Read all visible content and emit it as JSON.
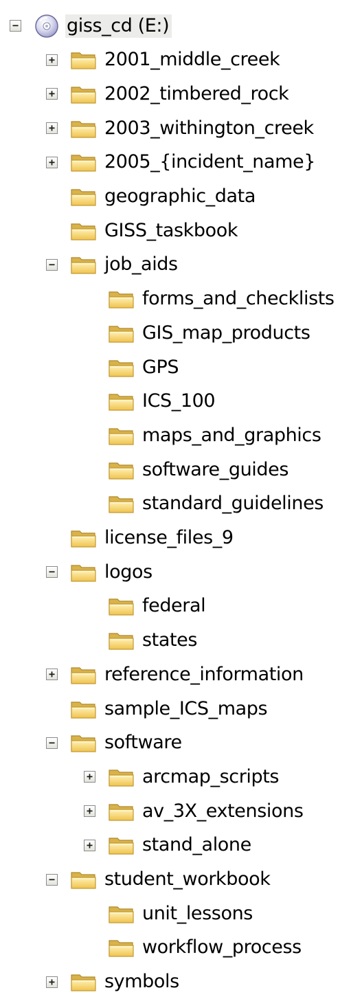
{
  "tree": {
    "root": {
      "label": "giss_cd (E:)",
      "expander": "−",
      "icon": "cd-drive-icon"
    },
    "items": [
      {
        "label": "2001_middle_creek",
        "expander": "+",
        "level": 1
      },
      {
        "label": "2002_timbered_rock",
        "expander": "+",
        "level": 1
      },
      {
        "label": "2003_withington_creek",
        "expander": "+",
        "level": 1
      },
      {
        "label": "2005_{incident_name}",
        "expander": "+",
        "level": 1
      },
      {
        "label": "geographic_data",
        "expander": "",
        "level": 1
      },
      {
        "label": "GISS_taskbook",
        "expander": "",
        "level": 1
      },
      {
        "label": "job_aids",
        "expander": "−",
        "level": 1
      },
      {
        "label": "forms_and_checklists",
        "expander": "",
        "level": 2
      },
      {
        "label": "GIS_map_products",
        "expander": "",
        "level": 2
      },
      {
        "label": "GPS",
        "expander": "",
        "level": 2
      },
      {
        "label": "ICS_100",
        "expander": "",
        "level": 2
      },
      {
        "label": "maps_and_graphics",
        "expander": "",
        "level": 2
      },
      {
        "label": "software_guides",
        "expander": "",
        "level": 2
      },
      {
        "label": "standard_guidelines",
        "expander": "",
        "level": 2
      },
      {
        "label": "license_files_9",
        "expander": "",
        "level": 1
      },
      {
        "label": "logos",
        "expander": "−",
        "level": 1
      },
      {
        "label": "federal",
        "expander": "",
        "level": 2
      },
      {
        "label": "states",
        "expander": "",
        "level": 2
      },
      {
        "label": "reference_information",
        "expander": "+",
        "level": 1
      },
      {
        "label": "sample_ICS_maps",
        "expander": "",
        "level": 1
      },
      {
        "label": "software",
        "expander": "−",
        "level": 1
      },
      {
        "label": "arcmap_scripts",
        "expander": "+",
        "level": 2
      },
      {
        "label": "av_3X_extensions",
        "expander": "+",
        "level": 2
      },
      {
        "label": "stand_alone",
        "expander": "+",
        "level": 2
      },
      {
        "label": "student_workbook",
        "expander": "−",
        "level": 1
      },
      {
        "label": "unit_lessons",
        "expander": "",
        "level": 2
      },
      {
        "label": "workflow_process",
        "expander": "",
        "level": 2
      },
      {
        "label": "symbols",
        "expander": "+",
        "level": 1
      }
    ]
  },
  "icons": {
    "folder": "folder-icon",
    "drive": "cd-drive-icon"
  },
  "colors": {
    "folder_fill": "#f6d468",
    "folder_dark": "#c9a23a",
    "expander_border": "#8a8a8a",
    "selection": "#ececea"
  }
}
